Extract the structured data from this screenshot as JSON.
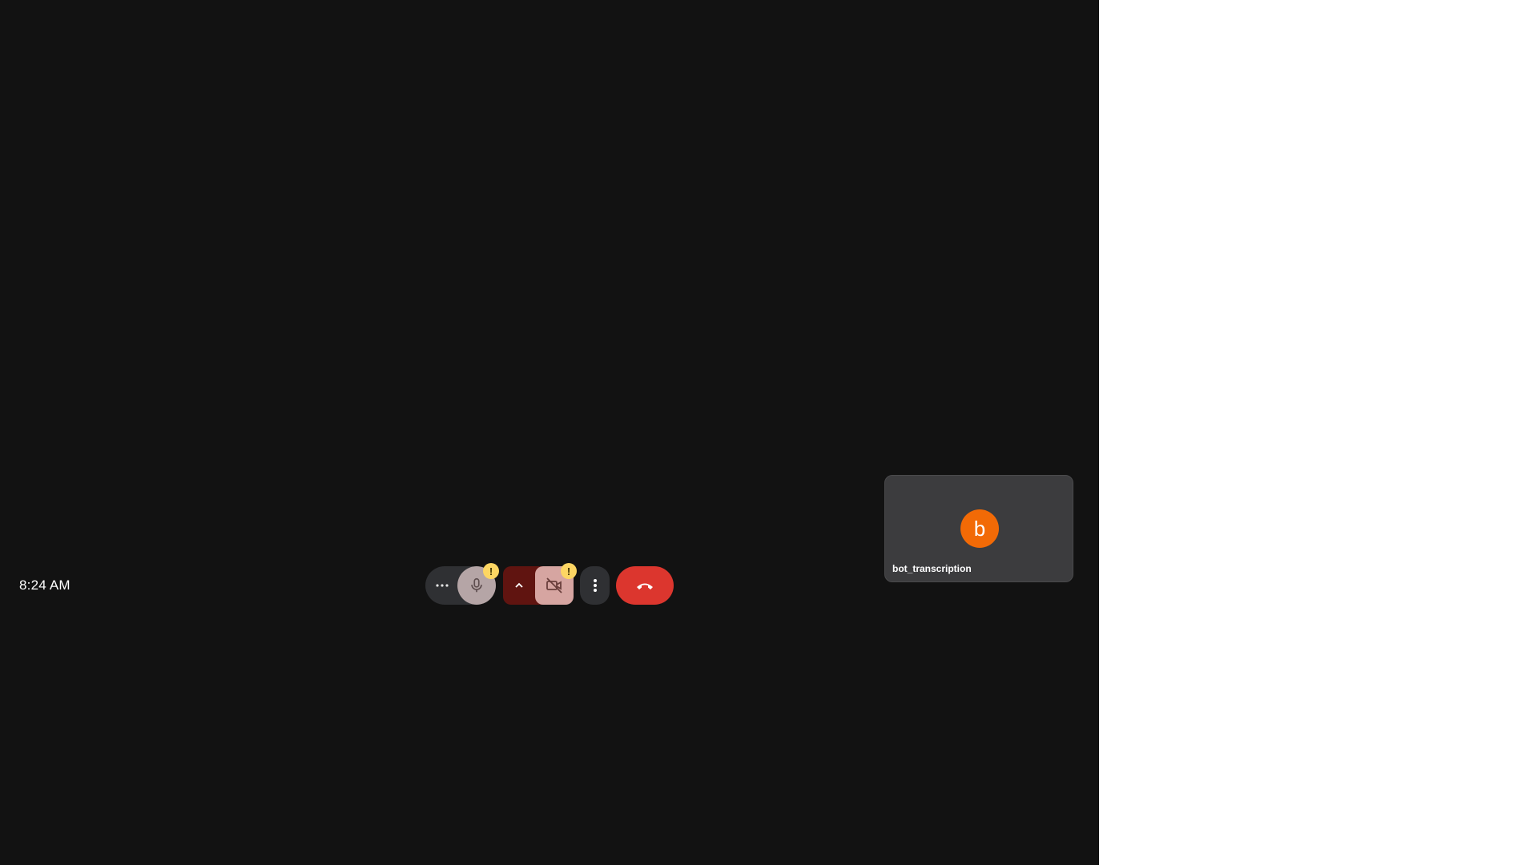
{
  "clock": {
    "time": "8:24 AM"
  },
  "controls": {
    "more_audio_options": {
      "icon": "more-horiz-icon"
    },
    "microphone": {
      "icon": "mic-icon",
      "warning_badge": "!"
    },
    "camera_options": {
      "icon": "chevron-up-icon"
    },
    "camera": {
      "icon": "videocam-off-icon",
      "warning_badge": "!"
    },
    "more_options": {
      "icon": "more-vert-icon"
    },
    "leave_call": {
      "icon": "call-end-icon"
    }
  },
  "self_tile": {
    "avatar_initial": "b",
    "participant_name": "bot_transcription"
  },
  "colors": {
    "stage_background": "#121212",
    "control_dark": "#2f3033",
    "mic_button": "#b5a5a6",
    "camera_options": "#601410",
    "camera_button": "#d6a5a1",
    "leave_button": "#dc362e",
    "warning_badge": "#fdd663",
    "avatar": "#f26a06",
    "tile": "#3c3c3e"
  }
}
